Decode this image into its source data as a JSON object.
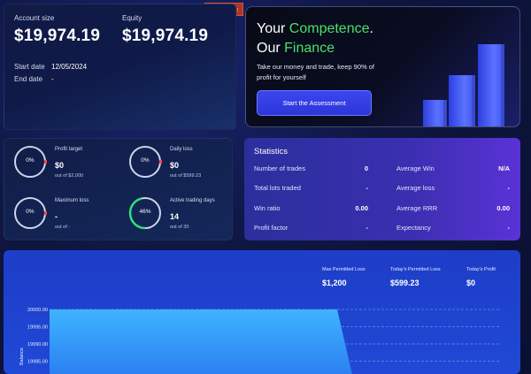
{
  "account": {
    "size_label": "Account size",
    "size_value": "$19,974.19",
    "equity_label": "Equity",
    "equity_value": "$19,974.19",
    "start_label": "Start date",
    "start_value": "12/05/2024",
    "end_label": "End date",
    "end_value": "-"
  },
  "promo": {
    "title_line1_a": "Your ",
    "title_line1_b": "Competence",
    "title_line1_c": ".",
    "title_line2_a": "Our ",
    "title_line2_b": "Finance",
    "subtitle": "Take our money and trade, keep 90% of profit for yourself",
    "button_label": "Start the Assessment",
    "accent_color": "#4ce06a"
  },
  "objectives": [
    {
      "title": "Profit target",
      "value": "$0",
      "sub": "out of $2,000",
      "percent_label": "0%",
      "percent": 0
    },
    {
      "title": "Daily loss",
      "value": "$0",
      "sub": "out of $599.23",
      "percent_label": "0%",
      "percent": 0
    },
    {
      "title": "Maximum loss",
      "value": "-",
      "sub": "out of -",
      "percent_label": "0%",
      "percent": 0
    },
    {
      "title": "Active trading days",
      "value": "14",
      "sub": "out of 30",
      "percent_label": "46%",
      "percent": 46
    }
  ],
  "statistics": {
    "title": "Statistics",
    "left": [
      {
        "label": "Number of trades",
        "value": "0"
      },
      {
        "label": "Total lots traded",
        "value": "-"
      },
      {
        "label": "Win ratio",
        "value": "0.00"
      },
      {
        "label": "Profit factor",
        "value": "-"
      }
    ],
    "right": [
      {
        "label": "Average Win",
        "value": "N/A"
      },
      {
        "label": "Average loss",
        "value": "-"
      },
      {
        "label": "Average RRR",
        "value": "0.00"
      },
      {
        "label": "Expectancy",
        "value": "-"
      }
    ]
  },
  "metrics": [
    {
      "title": "Max Permitted Loss",
      "value": "$1,200"
    },
    {
      "title": "Today's Permitted Loss",
      "value": "$599.23"
    },
    {
      "title": "Today's Profit",
      "value": "$0"
    }
  ],
  "chart_data": {
    "type": "area",
    "ylabel": "Balance",
    "yticks": [
      "20000.00",
      "19995.00",
      "19990.00",
      "19985.00"
    ],
    "y": [
      20000,
      20000,
      20000,
      20000,
      19980
    ]
  },
  "colors": {
    "ring_track": "#cfd4ea",
    "ring_progress": "#2fe07a",
    "ring_marker": "#ff4b4b"
  }
}
